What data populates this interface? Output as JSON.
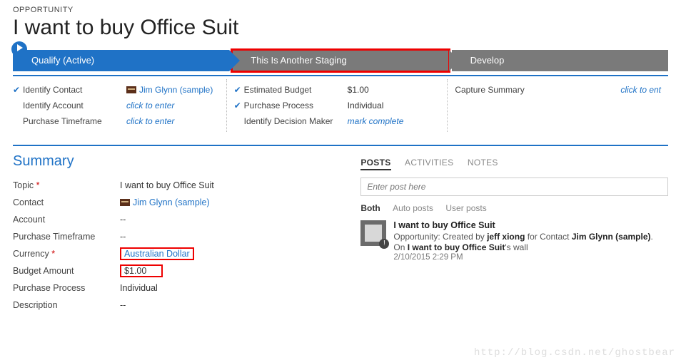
{
  "entity_label": "OPPORTUNITY",
  "record_title": "I want to buy Office Suit",
  "stages": {
    "s1": "Qualify (Active)",
    "s2": "This Is Another Staging",
    "s3": "Develop"
  },
  "qualify": {
    "r1_label": "Identify Contact",
    "r1_value": "Jim Glynn (sample)",
    "r2_label": "Identify Account",
    "r2_value": "click to enter",
    "r3_label": "Purchase Timeframe",
    "r3_value": "click to enter"
  },
  "staging": {
    "r1_label": "Estimated Budget",
    "r1_value": "$1.00",
    "r2_label": "Purchase Process",
    "r2_value": "Individual",
    "r3_label": "Identify Decision Maker",
    "r3_value": "mark complete"
  },
  "develop": {
    "r1_label": "Capture Summary",
    "r1_value": "click to ent"
  },
  "summary_heading": "Summary",
  "summary": {
    "topic_l": "Topic",
    "topic_v": "I want to buy Office Suit",
    "contact_l": "Contact",
    "contact_v": "Jim Glynn (sample)",
    "account_l": "Account",
    "account_v": "--",
    "pt_l": "Purchase Timeframe",
    "pt_v": "--",
    "curr_l": "Currency",
    "curr_v": "Australian Dollar",
    "budget_l": "Budget Amount",
    "budget_v": "$1.00",
    "pp_l": "Purchase Process",
    "pp_v": "Individual",
    "desc_l": "Description",
    "desc_v": "--"
  },
  "tabs": {
    "posts": "POSTS",
    "activities": "ACTIVITIES",
    "notes": "NOTES"
  },
  "post_placeholder": "Enter post here",
  "filters": {
    "both": "Both",
    "auto": "Auto posts",
    "user": "User posts"
  },
  "post": {
    "title": "I want to buy Office Suit",
    "prefix": "Opportunity: Created by ",
    "user": "jeff xiong",
    "mid": " for Contact ",
    "contact": "Jim Glynn (sample)",
    "suffix": ".",
    "wall_prefix": "On ",
    "wall_name": "I want to buy Office Suit",
    "wall_suffix": "'s wall",
    "time": "2/10/2015 2:29 PM"
  },
  "watermark": "http://blog.csdn.net/ghostbear"
}
